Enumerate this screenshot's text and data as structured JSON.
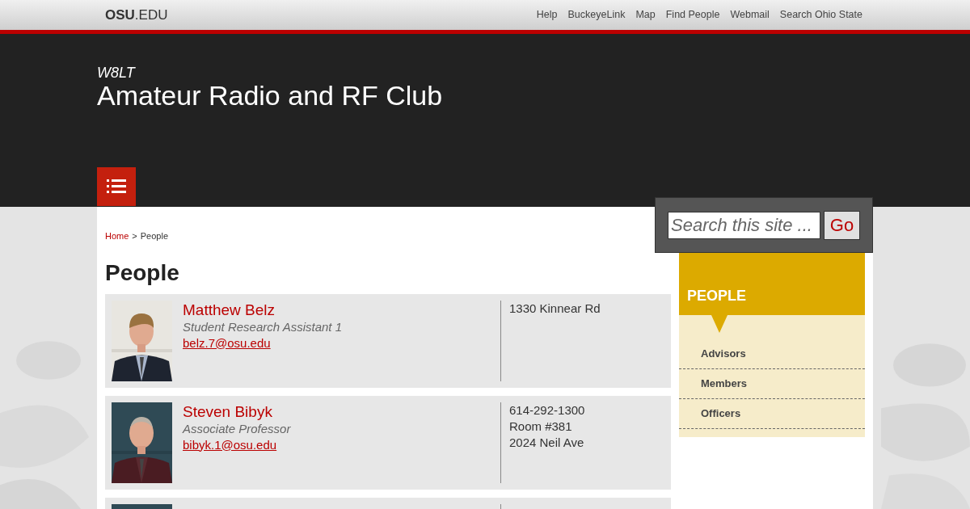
{
  "top_bar": {
    "logo_bold": "OSU",
    "logo_rest": ".EDU",
    "links": [
      "Help",
      "BuckeyeLink",
      "Map",
      "Find People",
      "Webmail",
      "Search Ohio State"
    ]
  },
  "header": {
    "callsign": "W8LT",
    "title": "Amateur Radio and RF Club"
  },
  "search": {
    "placeholder": "Search this site ...",
    "button": "Go"
  },
  "breadcrumb": {
    "home": "Home",
    "separator": ">",
    "current": "People"
  },
  "page_title": "People",
  "people": [
    {
      "photo": {
        "kind": "picture"
      },
      "name": "Matthew Belz",
      "role": "Student Research Assistant 1",
      "email": "belz.7@osu.edu",
      "details": [
        "1330 Kinnear Rd"
      ]
    },
    {
      "photo": {
        "kind": "picture"
      },
      "name": "Steven Bibyk",
      "role": "Associate Professor",
      "email": "bibyk.1@osu.edu",
      "details": [
        "614-292-1300",
        "Room #381",
        "2024 Neil Ave"
      ]
    },
    {
      "photo": {
        "kind": "picture"
      }
    }
  ],
  "sidebar": {
    "heading": "PEOPLE",
    "items": [
      "Advisors",
      "Members",
      "Officers"
    ]
  }
}
